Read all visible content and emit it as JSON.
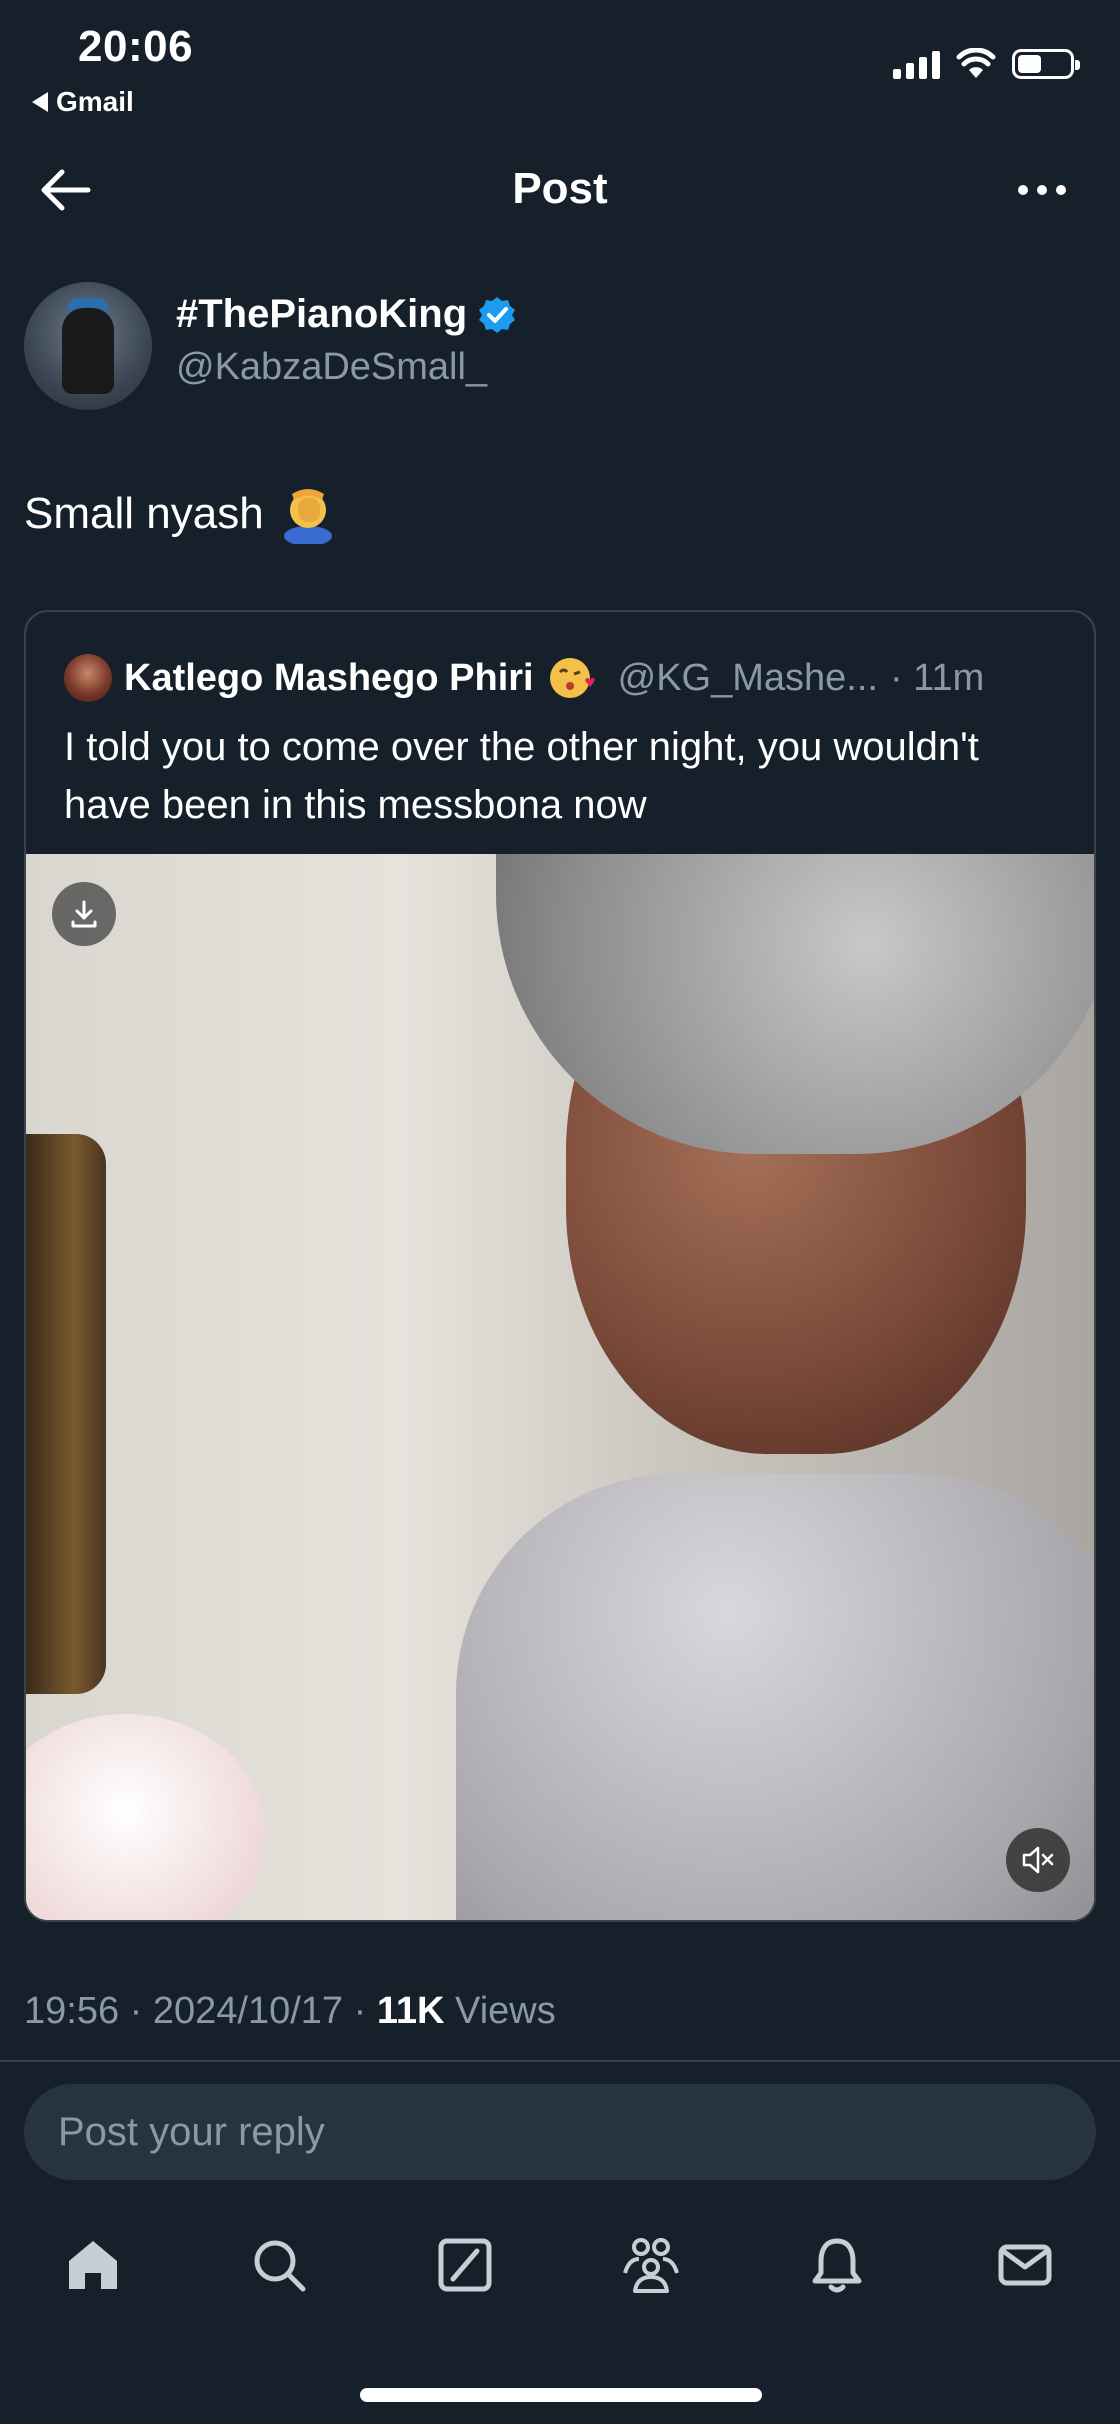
{
  "status_bar": {
    "time": "20:06",
    "back_app": "Gmail"
  },
  "header": {
    "title": "Post"
  },
  "post": {
    "display_name": "#ThePianoKing",
    "handle": "@KabzaDeSmall_",
    "text": "Small nyash",
    "emoji": "face-palm-emoji",
    "timestamp": "19:56",
    "date": "2024/10/17",
    "views_count": "11K",
    "views_label": "Views",
    "separator": "·"
  },
  "quoted_post": {
    "display_name": "Katlego Mashego Phiri",
    "emoji": "kissing-face-emoji",
    "handle": "@KG_Mashe...",
    "age": "· 11m",
    "text": "I told you to come over the other night, you wouldn't have been in this messbona now"
  },
  "reply": {
    "placeholder": "Post your reply"
  },
  "tabs": [
    {
      "name": "home-icon"
    },
    {
      "name": "search-icon"
    },
    {
      "name": "grok-icon"
    },
    {
      "name": "communities-icon"
    },
    {
      "name": "notifications-icon"
    },
    {
      "name": "messages-icon"
    }
  ],
  "colors": {
    "background": "#15202b",
    "accent": "#1d9bf0",
    "muted_text": "#8b98a5",
    "border": "#38444d"
  }
}
